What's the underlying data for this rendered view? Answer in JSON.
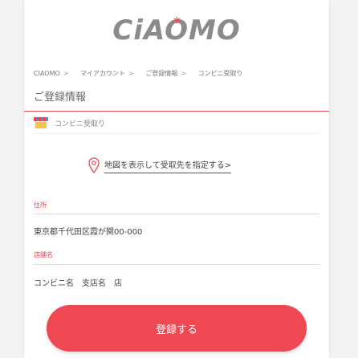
{
  "logo": {
    "first": "C",
    "rest": "iAOMO",
    "star": "*"
  },
  "breadcrumb": [
    {
      "label": "CIAOMO"
    },
    {
      "label": "マイアカウント"
    },
    {
      "label": "ご登録情報"
    },
    {
      "label": "コンビニ受取り"
    }
  ],
  "breadcrumb_sep": ">",
  "page_title": "ご登録情報",
  "store_type": {
    "label": "コンビニ受取り",
    "icon": "convenience-store-icon"
  },
  "map_link": {
    "label": "地図を表示して受取先を指定する>",
    "icon": "map-pin-icon"
  },
  "fields": {
    "address_label": "住所",
    "address_value": "東京都千代田区霞が関00-000",
    "store_name_label": "店舗名",
    "store_name_value": "コンビニ名　支店名　店"
  },
  "submit_button": {
    "label": "登録する"
  },
  "colors": {
    "accent": "#e9434f",
    "button": "#f04852"
  }
}
